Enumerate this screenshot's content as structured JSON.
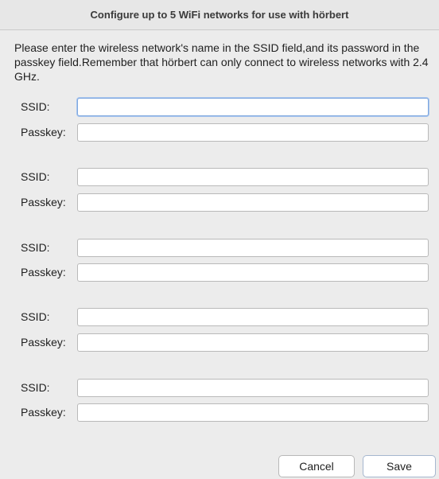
{
  "dialog": {
    "title": "Configure up to 5 WiFi networks for use with hörbert",
    "instructions": "Please enter the wireless network's name in the SSID field,and its password in the passkey field.Remember that hörbert can only connect to wireless networks with 2.4 GHz."
  },
  "labels": {
    "ssid": "SSID:",
    "passkey": "Passkey:"
  },
  "networks": [
    {
      "ssid": "",
      "passkey": ""
    },
    {
      "ssid": "",
      "passkey": ""
    },
    {
      "ssid": "",
      "passkey": ""
    },
    {
      "ssid": "",
      "passkey": ""
    },
    {
      "ssid": "",
      "passkey": ""
    }
  ],
  "buttons": {
    "cancel": "Cancel",
    "save": "Save"
  },
  "colors": {
    "background": "#ececec",
    "focus_ring": "#7fa7de"
  }
}
